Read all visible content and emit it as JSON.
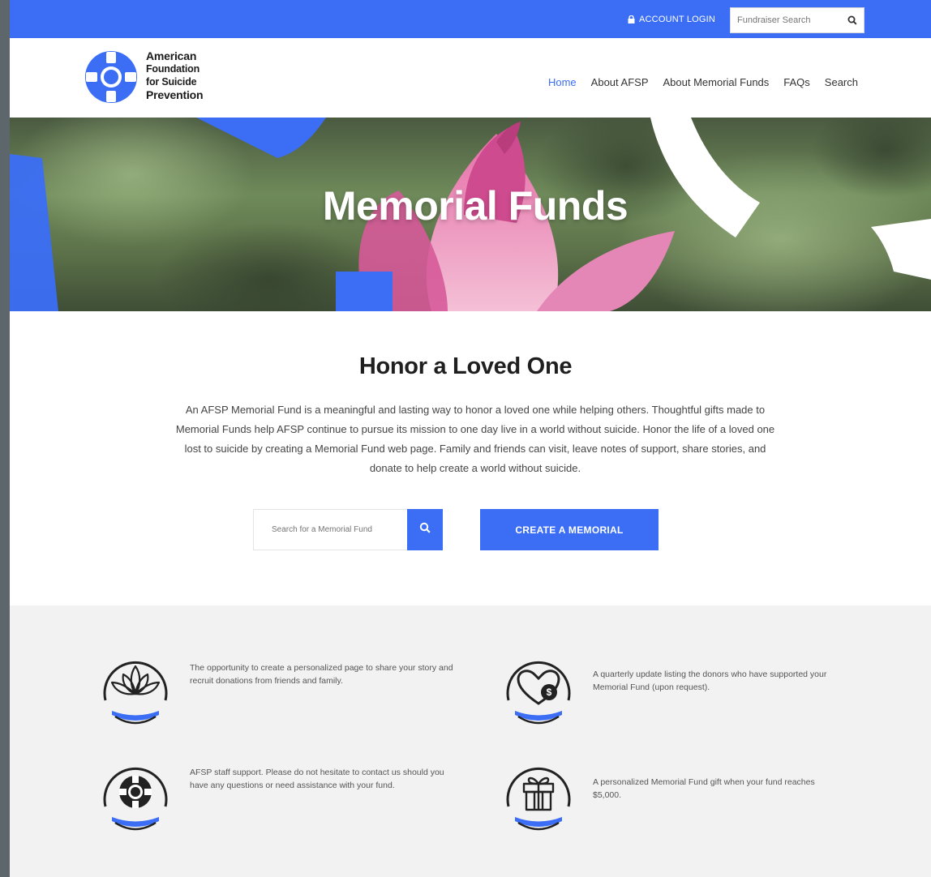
{
  "topbar": {
    "account_login": "ACCOUNT LOGIN",
    "fundraiser_search_placeholder": "Fundraiser Search"
  },
  "logo": {
    "line1": "American",
    "line2": "Foundation",
    "line3": "for Suicide",
    "line4": "Prevention"
  },
  "nav": {
    "items": [
      "Home",
      "About AFSP",
      "About Memorial Funds",
      "FAQs",
      "Search"
    ],
    "active": "Home"
  },
  "hero": {
    "title": "Memorial Funds"
  },
  "intro": {
    "title": "Honor a Loved One",
    "body": "An AFSP Memorial Fund is a meaningful and lasting way to honor a loved one while helping others. Thoughtful gifts made to Memorial Funds help AFSP continue to pursue its mission to one day live in a world without suicide. Honor the life of a loved one lost to suicide by creating a Memorial Fund web page. Family and friends can visit, leave notes of support, share stories, and donate to help create a world without suicide.",
    "search_placeholder": "Search for a Memorial Fund",
    "create_button": "CREATE A MEMORIAL"
  },
  "benefits": {
    "items": [
      {
        "icon": "lotus-icon",
        "text": "The opportunity to create a personalized page to share your story and recruit donations from friends and family."
      },
      {
        "icon": "heart-donation-icon",
        "text": "A quarterly update listing the donors who have supported your Memorial Fund (upon request)."
      },
      {
        "icon": "lifebuoy-icon",
        "text": "AFSP staff support. Please do not hesitate to contact us should you have any questions or need assistance with your fund."
      },
      {
        "icon": "gift-icon",
        "text": "A personalized Memorial Fund gift when your fund reaches $5,000."
      }
    ]
  },
  "colors": {
    "brand_blue": "#3b6ef5",
    "benefits_bg": "#f2f2f2",
    "frame_gray": "#5d666b"
  }
}
